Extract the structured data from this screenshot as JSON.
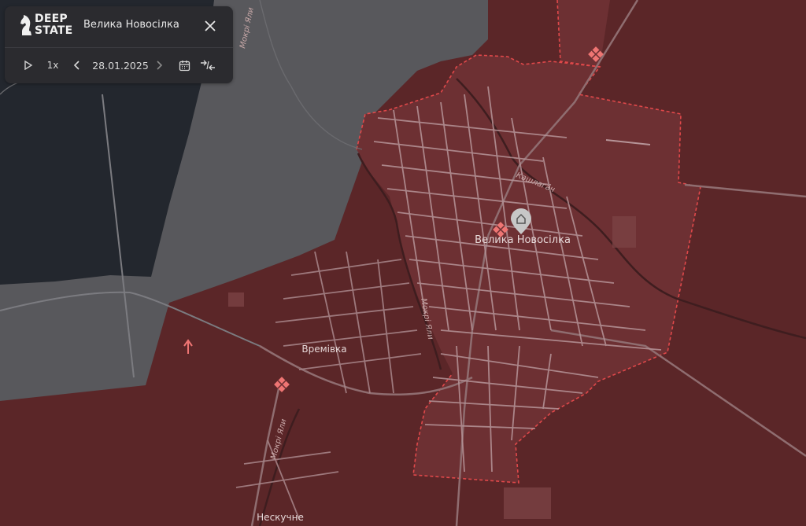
{
  "app": {
    "logo_line1": "DEEP",
    "logo_line2": "STATE",
    "location_title": "Велика Новосілка"
  },
  "controls": {
    "speed": "1x",
    "date": "28.01.2025"
  },
  "map": {
    "places": {
      "main": "Велика Новосілка",
      "west": "Времівка",
      "south": "Нескучне"
    },
    "rivers": {
      "north": "Мокрі Яли",
      "center": "Мокрі Яли",
      "south": "Мокрі Яли",
      "east": "Кашлагач"
    },
    "colors": {
      "occupied": "#5b2628",
      "contested": "#6d3033",
      "free": "#58585c",
      "dark_zone": "#23272e",
      "border_dashed": "#e0484a",
      "marker": "#ee7573"
    }
  }
}
